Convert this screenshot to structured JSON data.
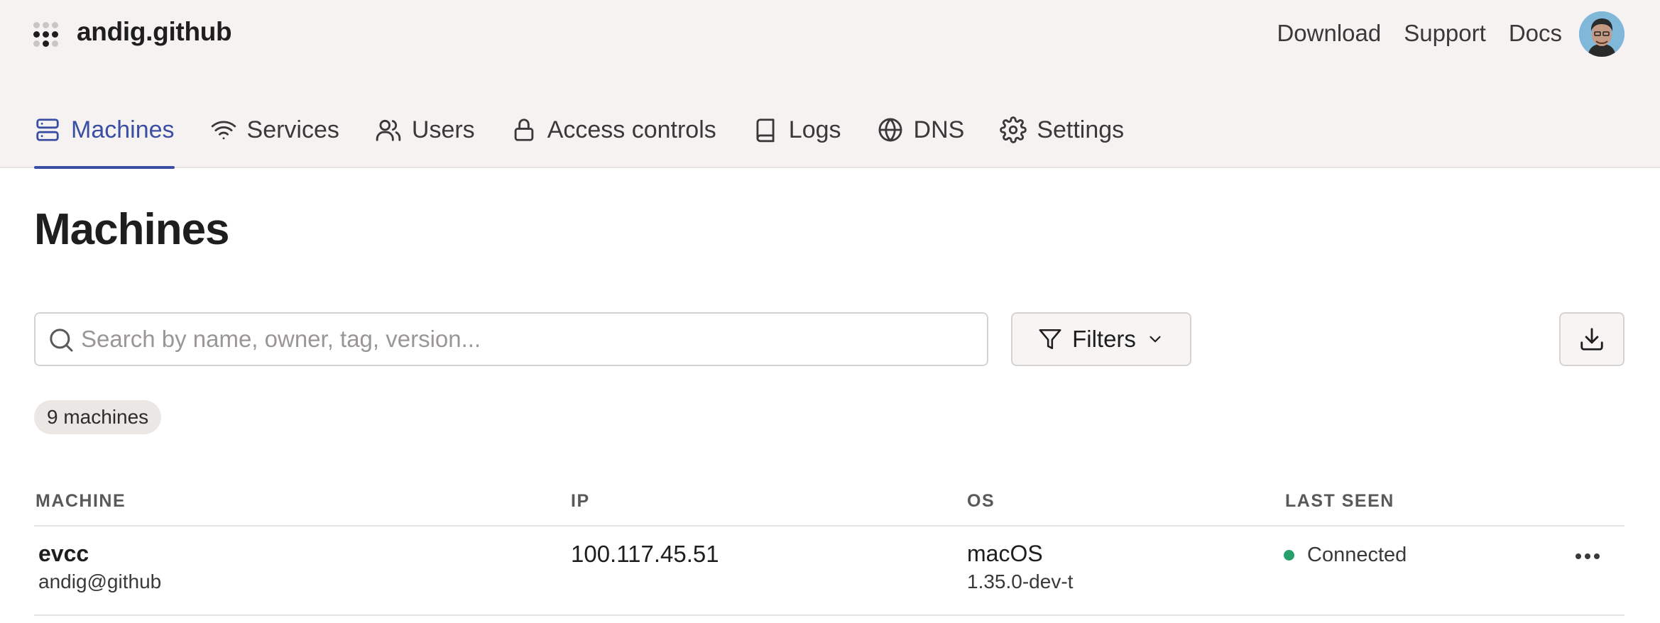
{
  "header": {
    "org_name": "andig.github",
    "links": [
      "Download",
      "Support",
      "Docs"
    ]
  },
  "nav": {
    "tabs": [
      {
        "label": "Machines",
        "icon": "server-icon",
        "active": true
      },
      {
        "label": "Services",
        "icon": "wifi-icon",
        "active": false
      },
      {
        "label": "Users",
        "icon": "users-icon",
        "active": false
      },
      {
        "label": "Access controls",
        "icon": "lock-icon",
        "active": false
      },
      {
        "label": "Logs",
        "icon": "book-icon",
        "active": false
      },
      {
        "label": "DNS",
        "icon": "globe-icon",
        "active": false
      },
      {
        "label": "Settings",
        "icon": "gear-icon",
        "active": false
      }
    ]
  },
  "page": {
    "title": "Machines"
  },
  "toolbar": {
    "search_placeholder": "Search by name, owner, tag, version...",
    "search_value": "",
    "filters_label": "Filters"
  },
  "summary": {
    "count_label": "9 machines"
  },
  "table": {
    "columns": [
      "MACHINE",
      "IP",
      "OS",
      "LAST SEEN"
    ],
    "rows": [
      {
        "name": "evcc",
        "owner": "andig@github",
        "ip": "100.117.45.51",
        "os": "macOS",
        "version": "1.35.0-dev-t",
        "last_seen": "Connected",
        "status_color": "#27a06b"
      }
    ]
  },
  "colors": {
    "accent": "#3a4fa3",
    "header_bg": "#f5f2f1",
    "connected": "#27a06b"
  }
}
